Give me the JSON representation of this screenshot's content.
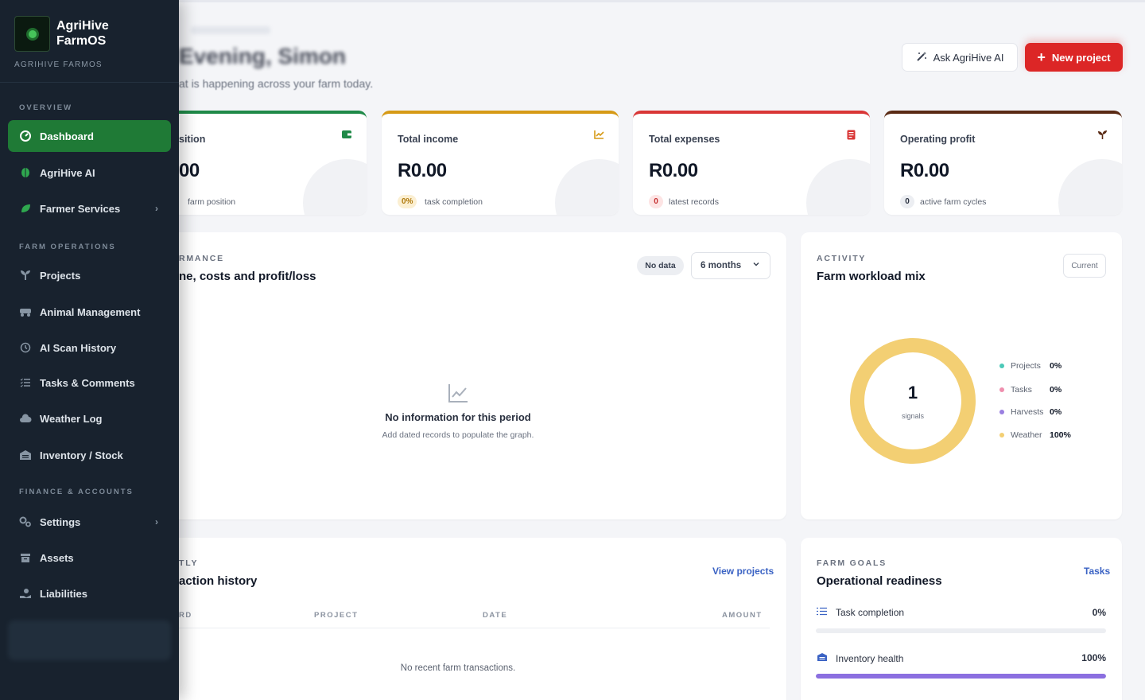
{
  "brand": {
    "name": "AgriHive FarmOS",
    "subtitle": "AGRIHIVE FARMOS"
  },
  "sidebar": {
    "sections": [
      "OVERVIEW",
      "FARM OPERATIONS",
      "FINANCE & ACCOUNTS"
    ],
    "items": [
      {
        "label": "Dashboard",
        "icon": "dashboard-icon",
        "active": true
      },
      {
        "label": "AgriHive AI",
        "icon": "leaf-icon"
      },
      {
        "label": "Farmer Services",
        "icon": "leaf-slanted-icon",
        "chevron": true
      },
      {
        "label": "Projects",
        "icon": "seedling-icon"
      },
      {
        "label": "Animal Management",
        "icon": "tractor-icon"
      },
      {
        "label": "AI Scan History",
        "icon": "history-icon"
      },
      {
        "label": "Tasks & Comments",
        "icon": "list-check-icon"
      },
      {
        "label": "Weather Log",
        "icon": "cloud-icon"
      },
      {
        "label": "Inventory / Stock",
        "icon": "warehouse-icon"
      },
      {
        "label": "Settings",
        "icon": "gears-icon",
        "chevron": true
      },
      {
        "label": "Assets",
        "icon": "archive-icon"
      },
      {
        "label": "Liabilities",
        "icon": "hand-coin-icon"
      }
    ]
  },
  "header": {
    "title": "Evening, Simon",
    "subtitle": "at is happening across your farm today.",
    "ask_ai": "Ask AgriHive AI",
    "new_project": "New project"
  },
  "stats": [
    {
      "label": "sition",
      "value": "00",
      "badge": "",
      "note": "farm position",
      "color": "#1f8a48",
      "icon": "wallet-icon"
    },
    {
      "label": "Total income",
      "value": "R0.00",
      "badge": "0%",
      "note": "task completion",
      "color": "#d69a16",
      "icon": "chart-line-icon"
    },
    {
      "label": "Total expenses",
      "value": "R0.00",
      "badge": "0",
      "note": "latest records",
      "color": "#d93636",
      "icon": "receipt-icon"
    },
    {
      "label": "Operating profit",
      "value": "R0.00",
      "badge": "0",
      "note": "active farm cycles",
      "color": "#5a2a14",
      "icon": "sprout-icon"
    }
  ],
  "performance": {
    "eyebrow": "RMANCE",
    "title": "ne, costs and profit/loss",
    "pill": "No data",
    "period": "6 months",
    "empty_title": "No information for this period",
    "empty_sub": "Add dated records to populate the graph."
  },
  "activity": {
    "eyebrow": "ACTIVITY",
    "title": "Farm workload mix",
    "button": "Current",
    "center_value": "1",
    "center_label": "signals",
    "legend": [
      {
        "label": "Projects",
        "value": "0%",
        "color": "#4cc9b8"
      },
      {
        "label": "Tasks",
        "value": "0%",
        "color": "#ef8fae"
      },
      {
        "label": "Harvests",
        "value": "0%",
        "color": "#9a7fe0"
      },
      {
        "label": "Weather",
        "value": "100%",
        "color": "#f3cf73"
      }
    ]
  },
  "transactions": {
    "eyebrow": "TLY",
    "title": "action history",
    "link": "View projects",
    "columns": [
      "RD",
      "PROJECT",
      "DATE",
      "AMOUNT"
    ],
    "empty": "No recent farm transactions."
  },
  "goals": {
    "eyebrow": "FARM GOALS",
    "title": "Operational readiness",
    "link": "Tasks",
    "items": [
      {
        "label": "Task completion",
        "value": "0%",
        "percent": 0,
        "icon": "list-icon"
      },
      {
        "label": "Inventory health",
        "value": "100%",
        "percent": 100,
        "icon": "warehouse-icon"
      }
    ]
  }
}
